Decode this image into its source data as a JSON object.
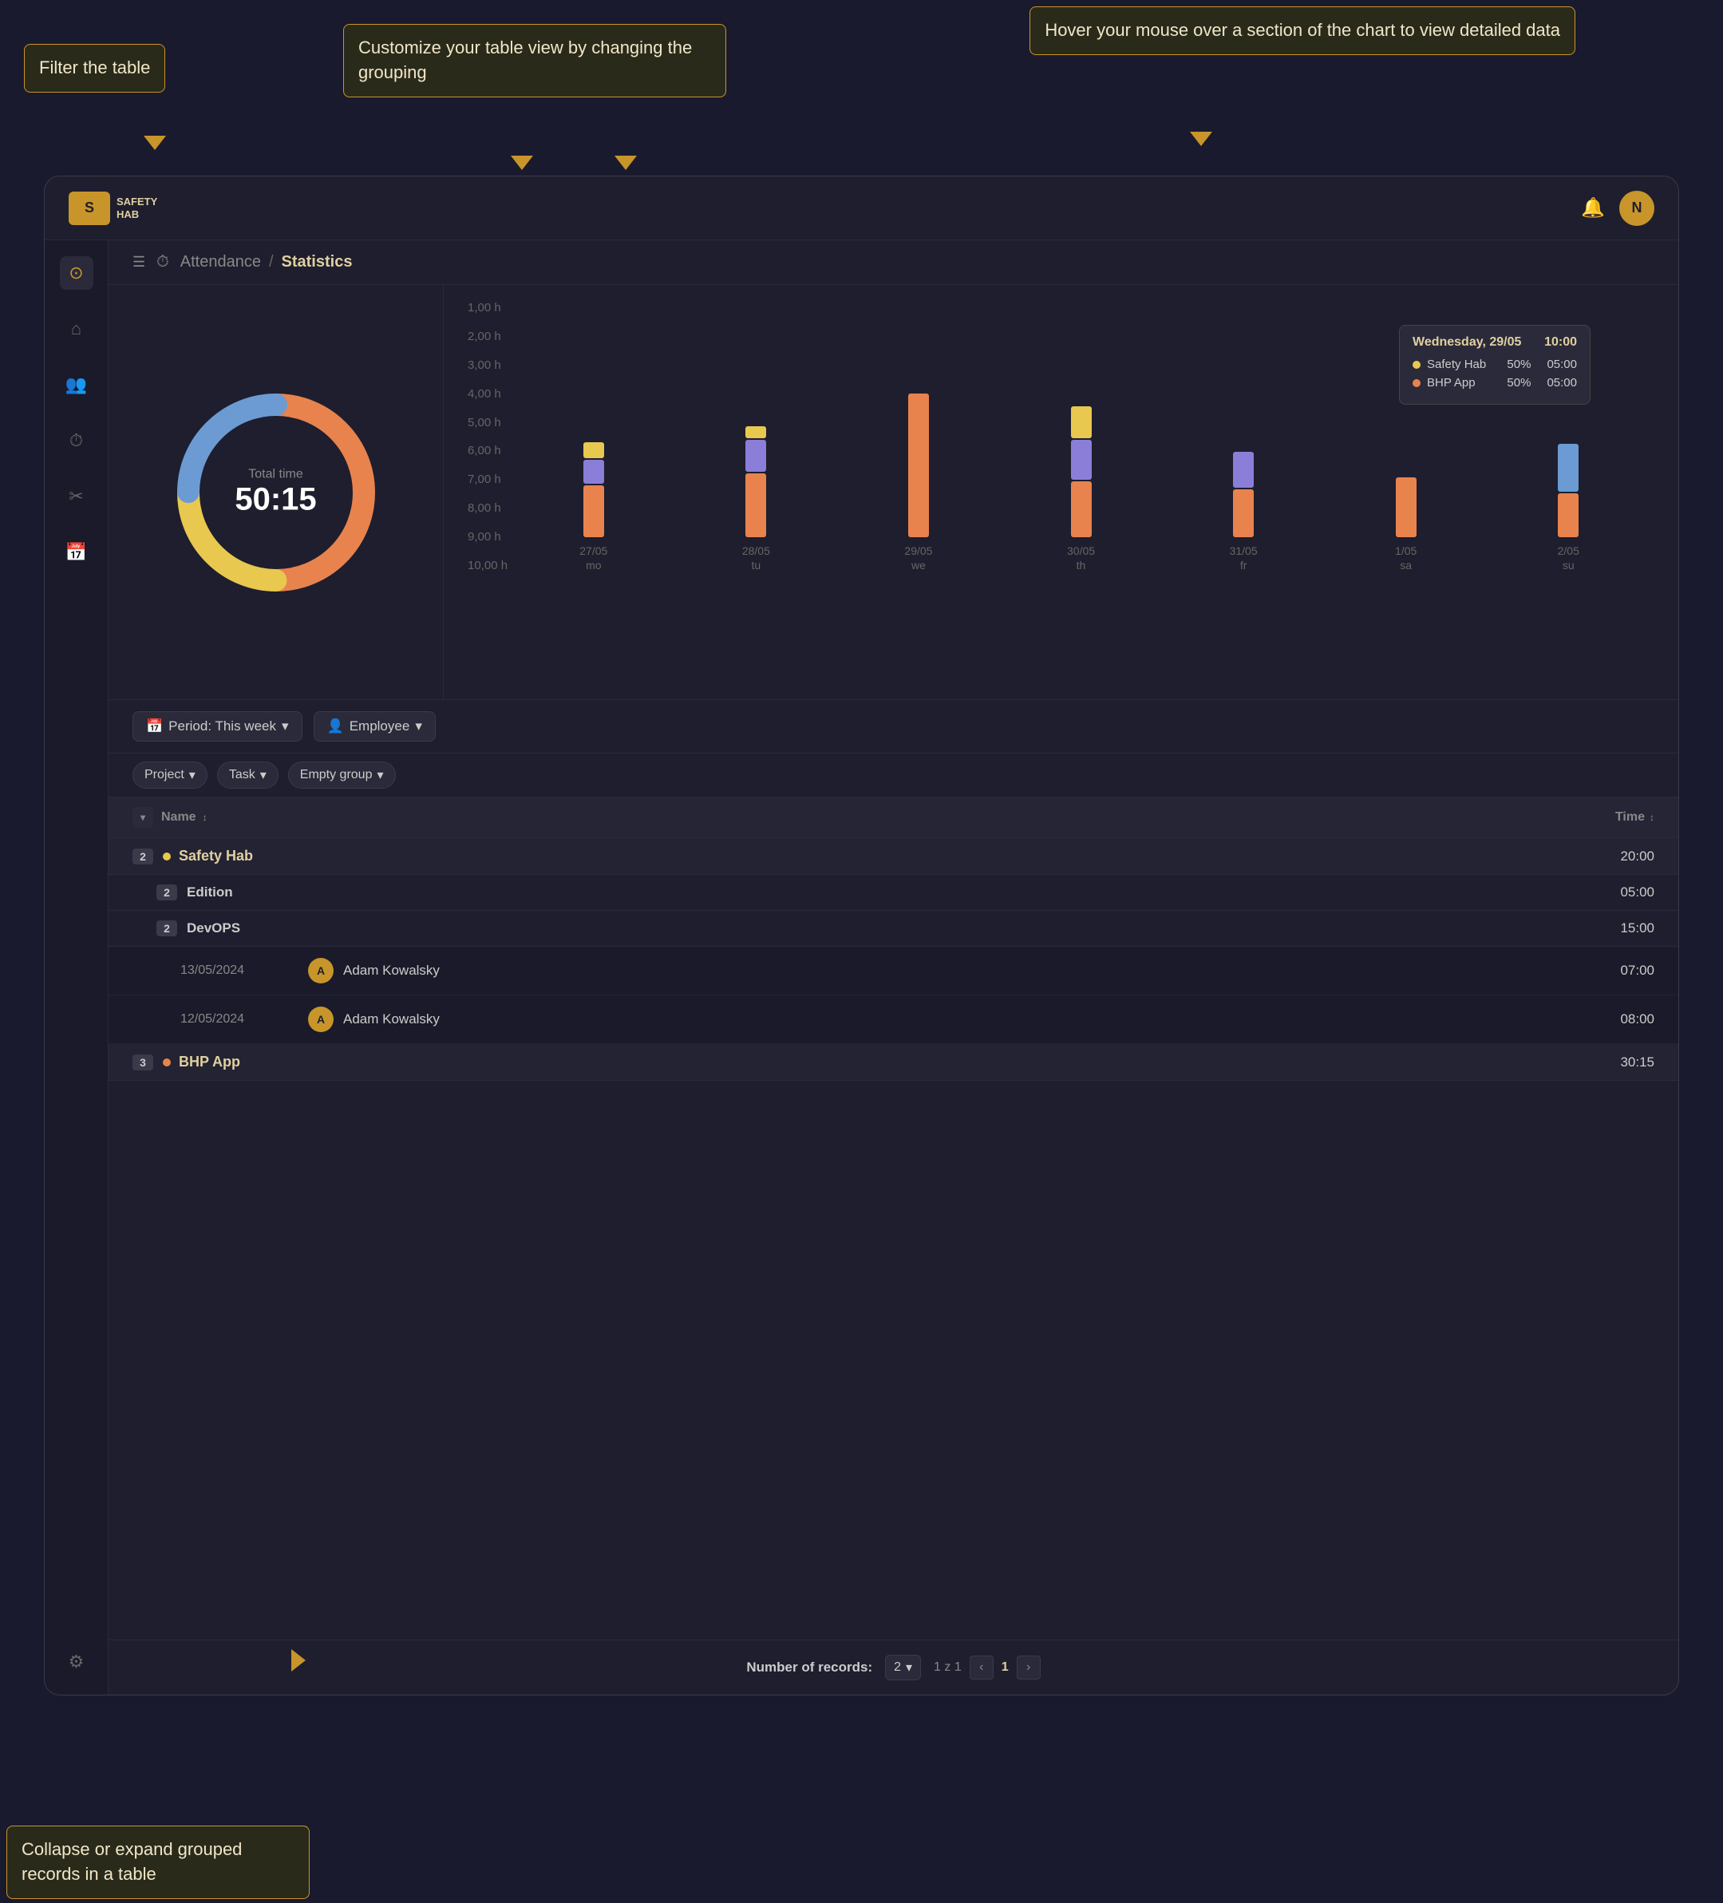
{
  "tooltips": {
    "filter": "Filter the table",
    "grouping": "Customize your table view by changing the grouping",
    "chart_hover": "Hover your mouse over a section of the chart to view detailed data",
    "collapse": "Collapse or expand grouped records in a table"
  },
  "app": {
    "logo_text_line1": "SAFETY",
    "logo_text_line2": "HAB",
    "logo_letter": "S",
    "header_bell": "🔔",
    "header_avatar": "N"
  },
  "breadcrumb": {
    "parent": "Attendance",
    "separator": "/",
    "current": "Statistics"
  },
  "donut": {
    "label": "Total time",
    "value": "50:15"
  },
  "chart": {
    "y_labels": [
      "1,00 h",
      "2,00 h",
      "3,00 h",
      "4,00 h",
      "5,00 h",
      "6,00 h",
      "7,00 h",
      "8,00 h",
      "9,00 h",
      "10,00 h"
    ],
    "days": [
      {
        "label": "27/05\nmo",
        "bars": [
          {
            "color": "#E8834E",
            "h": 65
          },
          {
            "color": "#8B7ED8",
            "h": 30
          },
          {
            "color": "#E8C84E",
            "h": 20
          }
        ]
      },
      {
        "label": "28/05\ntu",
        "bars": [
          {
            "color": "#E8834E",
            "h": 80
          },
          {
            "color": "#8B7ED8",
            "h": 40
          },
          {
            "color": "#E8C84E",
            "h": 15
          }
        ]
      },
      {
        "label": "29/05\nwe",
        "bars": [
          {
            "color": "#E8834E",
            "h": 180
          },
          {
            "color": "#8B7ED8",
            "h": 0
          },
          {
            "color": "#E8C84E",
            "h": 0
          }
        ]
      },
      {
        "label": "30/05\nth",
        "bars": [
          {
            "color": "#E8834E",
            "h": 70
          },
          {
            "color": "#8B7ED8",
            "h": 50
          },
          {
            "color": "#E8C84E",
            "h": 40
          }
        ]
      },
      {
        "label": "31/05\nfr",
        "bars": [
          {
            "color": "#E8834E",
            "h": 60
          },
          {
            "color": "#8B7ED8",
            "h": 45
          },
          {
            "color": "#E8C84E",
            "h": 0
          }
        ]
      },
      {
        "label": "1/05\nsa",
        "bars": [
          {
            "color": "#E8834E",
            "h": 75
          },
          {
            "color": "#8B7ED8",
            "h": 0
          },
          {
            "color": "#E8C84E",
            "h": 0
          }
        ]
      },
      {
        "label": "2/05\nsu",
        "bars": [
          {
            "color": "#E8834E",
            "h": 55
          },
          {
            "color": "#8B7ED8",
            "h": 60
          },
          {
            "color": "#E8C84E",
            "h": 0
          }
        ]
      }
    ],
    "tooltip": {
      "date": "Wednesday, 29/05",
      "time": "10:00",
      "rows": [
        {
          "dot_color": "#E8C84E",
          "label": "Safety Hab",
          "pct": "50%",
          "time": "05:00"
        },
        {
          "dot_color": "#E8834E",
          "label": "BHP App",
          "pct": "50%",
          "time": "05:00"
        }
      ]
    }
  },
  "controls": {
    "period_label": "Period: This week",
    "employee_label": "Employee"
  },
  "grouping": {
    "project_label": "Project",
    "task_label": "Task",
    "empty_group_label": "Empty group"
  },
  "table": {
    "col_name": "Name",
    "col_time": "Time",
    "groups": [
      {
        "badge": "2",
        "dot_color": "#E8C84E",
        "name": "Safety Hab",
        "time": "20:00",
        "subgroups": [
          {
            "badge": "2",
            "name": "Edition",
            "time": "05:00",
            "children": []
          },
          {
            "badge": "2",
            "name": "DevOPS",
            "time": "15:00",
            "children": [
              {
                "date": "13/05/2024",
                "avatar": "A",
                "name": "Adam Kowalsky",
                "time": "07:00"
              },
              {
                "date": "12/05/2024",
                "avatar": "A",
                "name": "Adam Kowalsky",
                "time": "08:00"
              }
            ]
          }
        ]
      },
      {
        "badge": "3",
        "dot_color": "#E8834E",
        "name": "BHP App",
        "time": "30:15",
        "subgroups": []
      }
    ]
  },
  "pagination": {
    "records_label": "Number of records:",
    "records_value": "2",
    "page_info": "1 z 1",
    "page_current": "1"
  },
  "sidebar": {
    "items": [
      {
        "icon": "⊙",
        "active": true
      },
      {
        "icon": "⌂",
        "active": false
      },
      {
        "icon": "👥",
        "active": false
      },
      {
        "icon": "⏱",
        "active": false
      },
      {
        "icon": "✂",
        "active": false
      },
      {
        "icon": "📅",
        "active": false
      }
    ],
    "bottom_icon": "⚙"
  }
}
